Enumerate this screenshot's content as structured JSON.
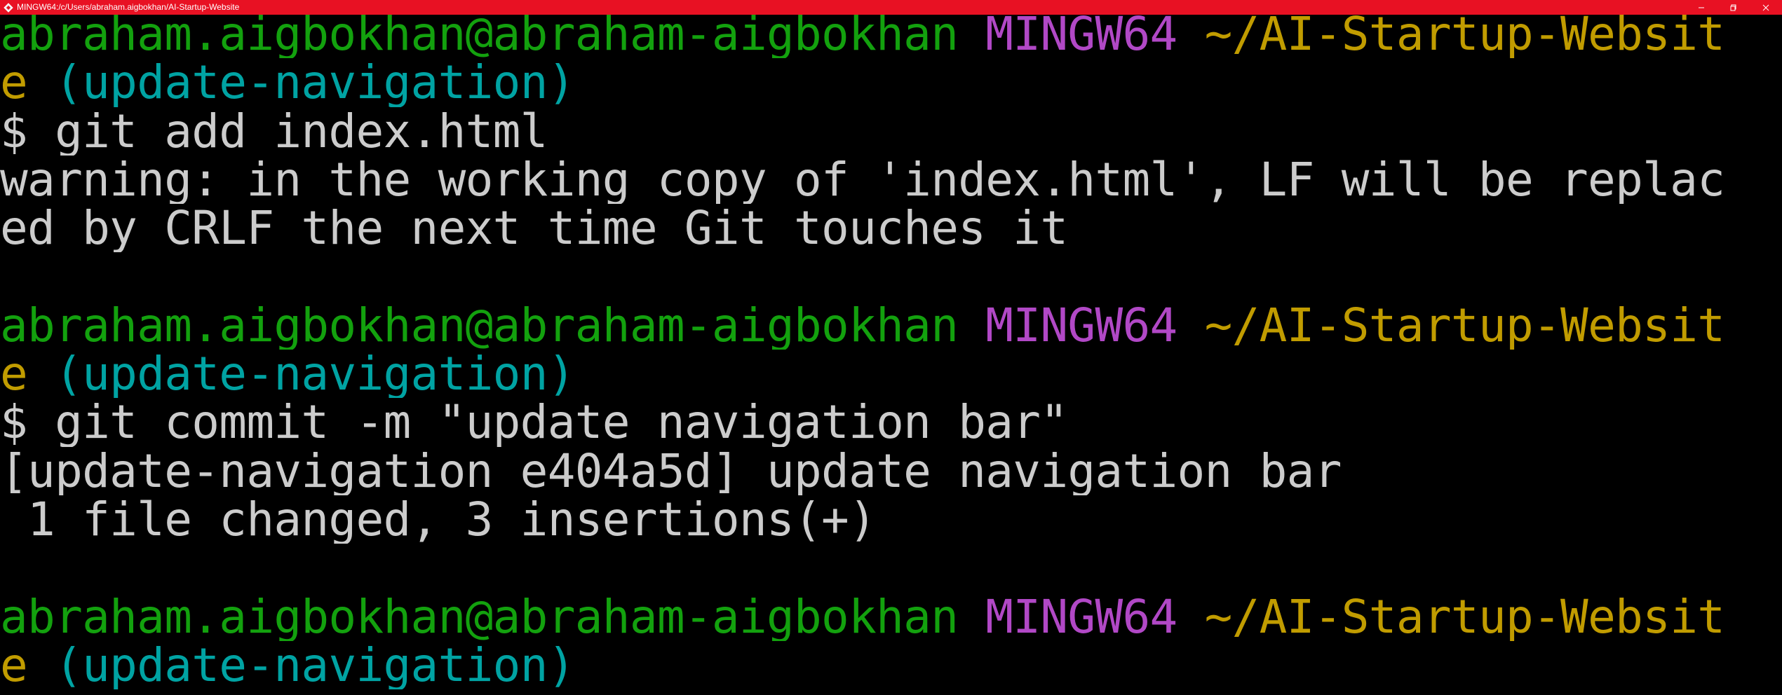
{
  "window": {
    "title": "MINGW64:/c/Users/abraham.aigbokhan/AI-Startup-Website",
    "controls": {
      "minimize_icon": "minimize-icon",
      "maximize_icon": "maximize-icon",
      "close_icon": "close-icon"
    },
    "colors": {
      "titlebar": "#e81123",
      "background": "#000000",
      "user": "#13a10e",
      "system": "#b148c6",
      "path": "#c19c00",
      "branch": "#00a3a3",
      "output": "#cccccc"
    }
  },
  "terminal": {
    "lines": [
      {
        "user": "abraham.aigbokhan@abraham-aigbokhan",
        "sep": " ",
        "system": "MINGW64",
        "sep2": " ",
        "path": "~/AI-Startup-Websit"
      },
      {
        "path_cont": "e",
        "sep": " ",
        "branch": "(update-navigation)"
      },
      {
        "text": "$ git add index.html"
      },
      {
        "text": "warning: in the working copy of 'index.html', LF will be replac"
      },
      {
        "text": "ed by CRLF the next time Git touches it"
      },
      {
        "text": ""
      },
      {
        "user": "abraham.aigbokhan@abraham-aigbokhan",
        "sep": " ",
        "system": "MINGW64",
        "sep2": " ",
        "path": "~/AI-Startup-Websit"
      },
      {
        "path_cont": "e",
        "sep": " ",
        "branch": "(update-navigation)"
      },
      {
        "text": "$ git commit -m \"update navigation bar\""
      },
      {
        "text": "[update-navigation e404a5d] update navigation bar"
      },
      {
        "text": " 1 file changed, 3 insertions(+)"
      },
      {
        "text": ""
      },
      {
        "user": "abraham.aigbokhan@abraham-aigbokhan",
        "sep": " ",
        "system": "MINGW64",
        "sep2": " ",
        "path": "~/AI-Startup-Websit"
      },
      {
        "path_cont": "e",
        "sep": " ",
        "branch": "(update-navigation)"
      }
    ]
  }
}
